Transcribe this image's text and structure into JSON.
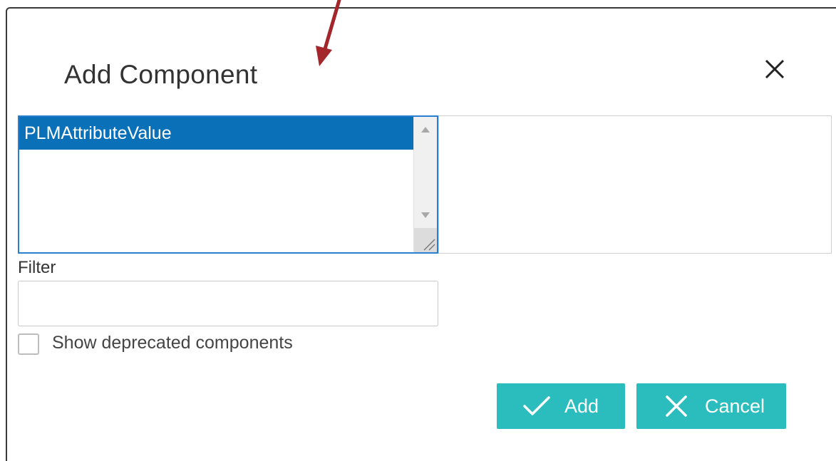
{
  "dialog": {
    "title": "Add Component",
    "close_icon": "close-icon"
  },
  "component_list": {
    "items": [
      {
        "label": "PLMAttributeValue",
        "selected": true
      }
    ],
    "scroll_up_icon": "triangle-up-icon",
    "scroll_down_icon": "triangle-down-icon",
    "resize_icon": "resize-grip-icon"
  },
  "filter": {
    "label": "Filter",
    "value": "",
    "placeholder": ""
  },
  "show_deprecated": {
    "label": "Show deprecated components",
    "checked": false
  },
  "buttons": {
    "add": {
      "label": "Add",
      "icon": "checkmark-icon"
    },
    "cancel": {
      "label": "Cancel",
      "icon": "close-icon"
    }
  },
  "colors": {
    "accent": "#2bbdbd",
    "selection": "#0a70b8",
    "focus_border": "#2b7fd0",
    "annotation_arrow": "#a3262b"
  }
}
